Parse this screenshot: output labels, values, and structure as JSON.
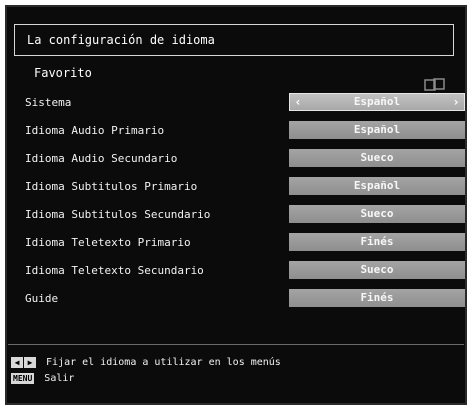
{
  "screen": {
    "title": "La configuración de idioma",
    "section": "Favorito"
  },
  "settings": [
    {
      "label": "Sistema",
      "value": "Español",
      "selected": true
    },
    {
      "label": "Idioma Audio Primario",
      "value": "Español"
    },
    {
      "label": "Idioma Audio Secundario",
      "value": "Sueco"
    },
    {
      "label": "Idioma Subtitulos Primario",
      "value": "Español"
    },
    {
      "label": "Idioma Subtitulos Secundario",
      "value": "Sueco"
    },
    {
      "label": "Idioma Teletexto Primario",
      "value": "Finés"
    },
    {
      "label": "Idioma Teletexto Secundario",
      "value": "Sueco"
    },
    {
      "label": "Guide",
      "value": "Finés"
    }
  ],
  "help": {
    "arrows_text": "Fijar el idioma a utilizar en los menús",
    "menu_key": "MENU",
    "menu_text": "Salir"
  },
  "icons": {
    "favorito": "subtitle-languages-icon",
    "left": "arrow-left-icon",
    "right": "arrow-right-icon"
  }
}
